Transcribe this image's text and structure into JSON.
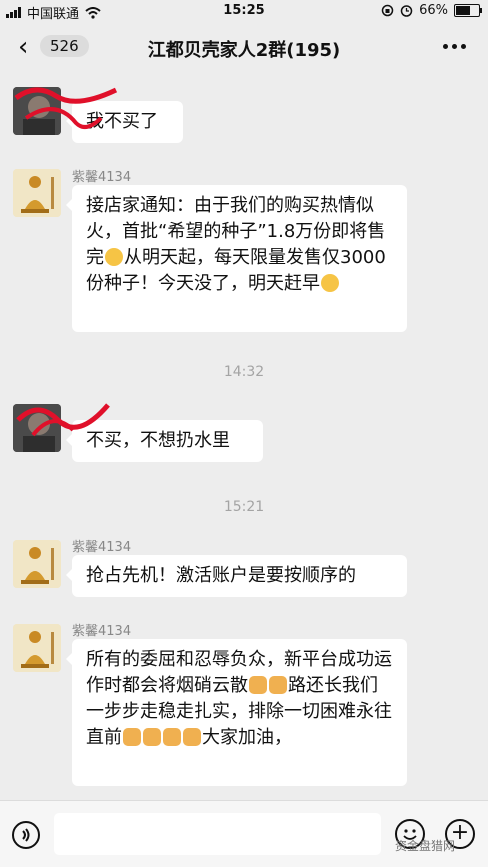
{
  "status_bar": {
    "carrier": "中国联通",
    "time": "15:25",
    "battery": "66%"
  },
  "nav": {
    "unread_count": "526",
    "title": "江都贝壳家人2群(195)"
  },
  "messages": [
    {
      "nick": "",
      "text": "我不买了"
    },
    {
      "nick": "紫馨4134",
      "text": "接店家通知：由于我们的购买热情似火，首批“希望的种子”1.8万份即将售完"
    },
    {
      "nick": "",
      "text": "不买，不想扔水里"
    },
    {
      "nick": "紫馨4134",
      "text": "抢占先机！激活账户是要按顺序的"
    },
    {
      "nick": "紫馨4134",
      "text": "所有的委屈和忍辱负众，新平台成功运作时都会将烟硝云散"
    }
  ],
  "msg2_part2": "从明天起，每天限量发售仅3000份种子！今天没了，明天赶早",
  "msg5_part2": "路还长我们一步步走稳走扎实，排除一切困难永往直前",
  "msg5_part3": "大家加油，",
  "timestamps": [
    "14:32",
    "15:21"
  ],
  "watermark": "资金盘猎网",
  "colors": {
    "background": "#ededed",
    "bubble": "#ffffff",
    "scribble": "#e0102a"
  }
}
